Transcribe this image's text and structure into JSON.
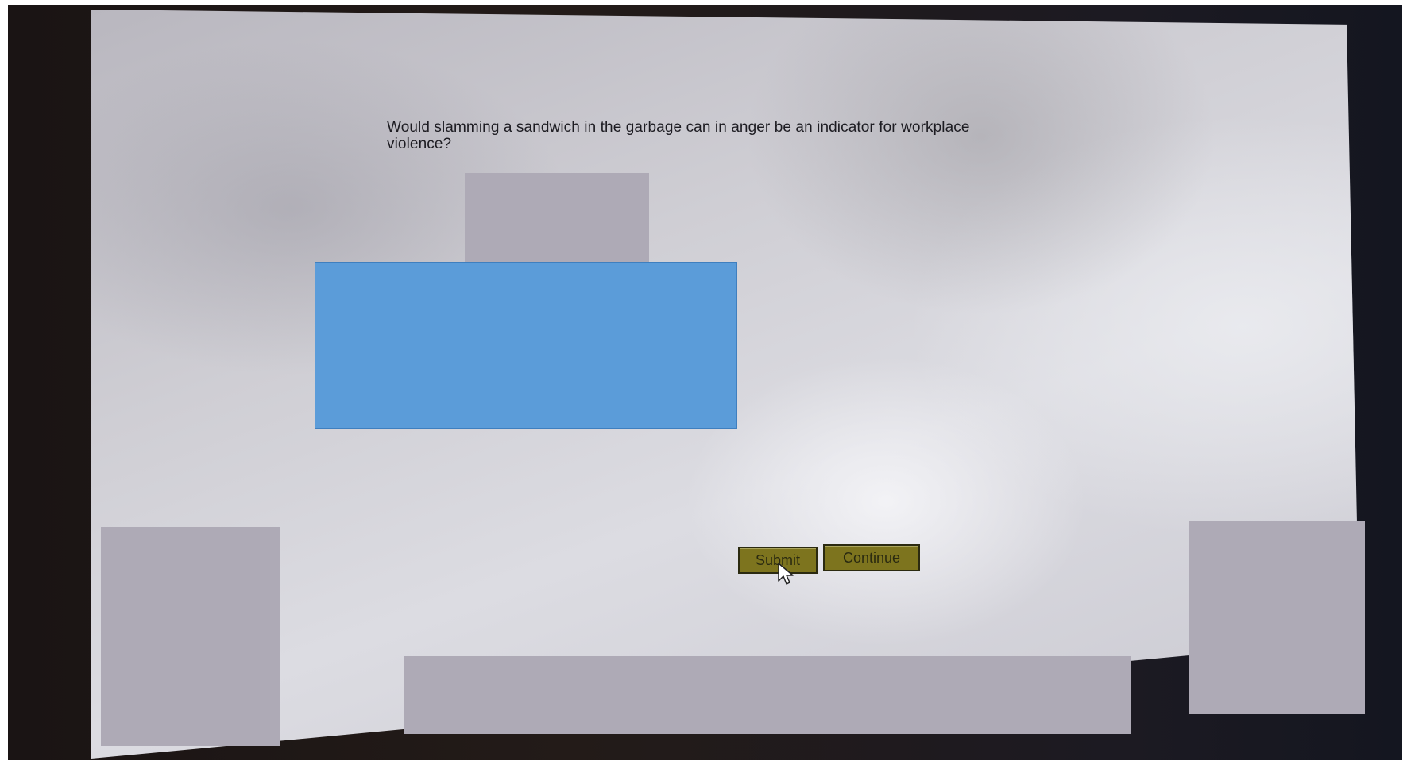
{
  "question": {
    "text": "Would slamming a sandwich in the garbage can in anger be an indicator for workplace violence?"
  },
  "buttons": {
    "submit_label": "Submit",
    "continue_label": "Continue"
  },
  "colors": {
    "answer_panel": "#5b9cd9",
    "button_fill": "#7d741e",
    "redaction": "#aeaab6"
  },
  "icons": {
    "cursor": "mouse-pointer-icon"
  }
}
